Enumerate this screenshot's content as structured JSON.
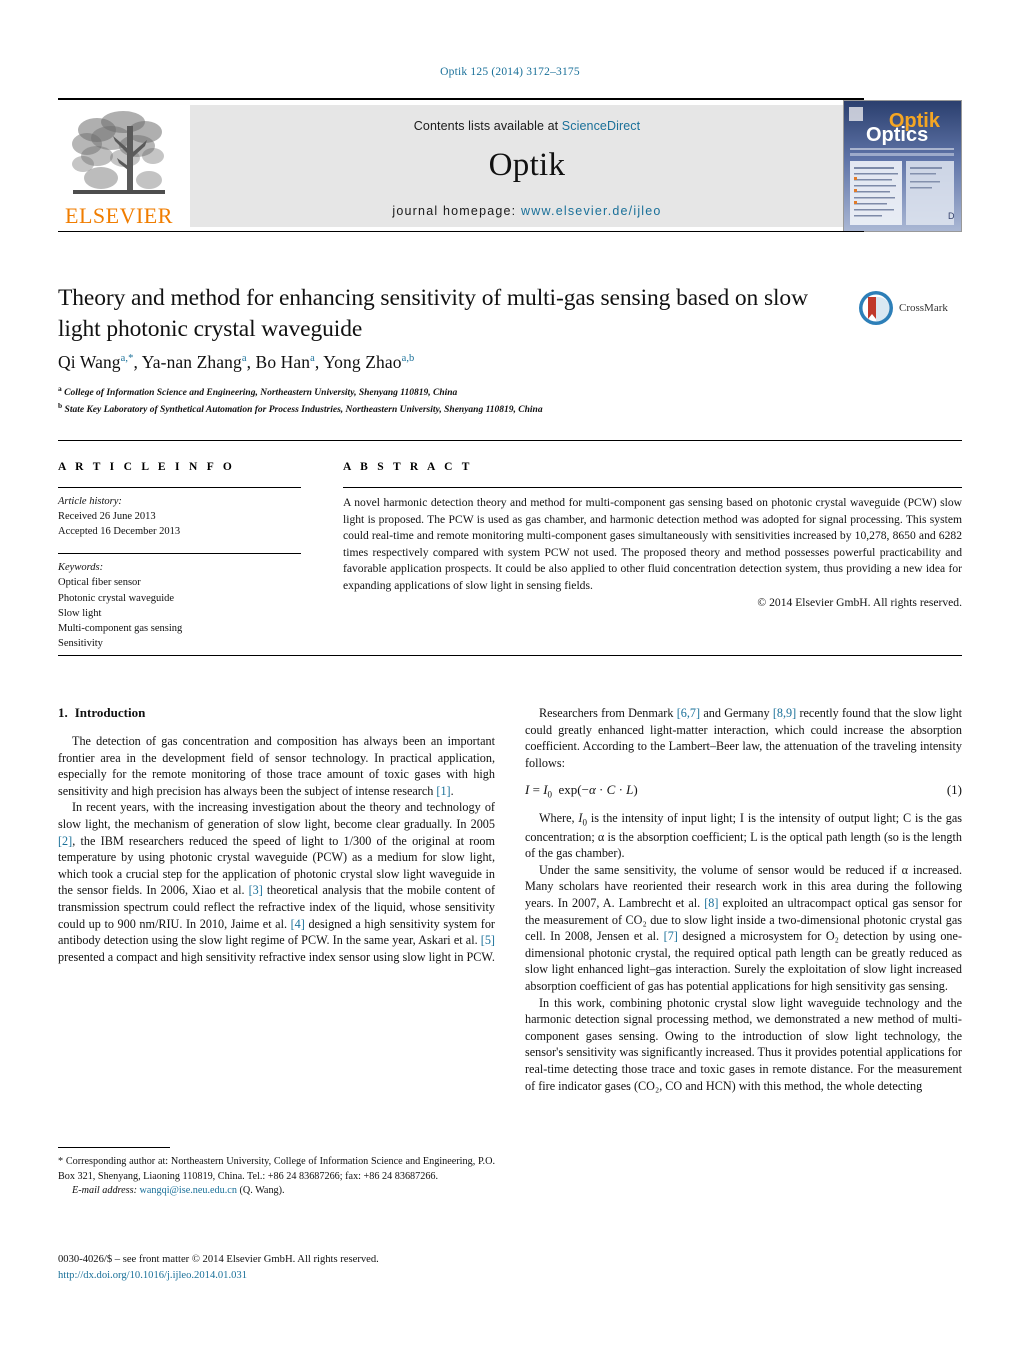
{
  "running_head": "Optik 125 (2014) 3172–3175",
  "masthead": {
    "publisher": "ELSEVIER",
    "contents_prefix": "Contents lists available at ",
    "contents_link": "ScienceDirect",
    "journal_name": "Optik",
    "homepage_prefix": "journal homepage:",
    "homepage_url": "www.elsevier.de/ijleo",
    "cover_title_top": "Optik",
    "cover_title_bottom": "Optics"
  },
  "title": "Theory and method for enhancing sensitivity of multi-gas sensing based on slow light photonic crystal waveguide",
  "crossmark_label": "CrossMark",
  "authors_html": "Qi Wang<sup>a,*</sup>, Ya-nan Zhang<sup>a</sup>, Bo Han<sup>a</sup>, Yong Zhao<sup>a,b</sup>",
  "affiliations": [
    "College of Information Science and Engineering, Northeastern University, Shenyang 110819, China",
    "State Key Laboratory of Synthetical Automation for Process Industries, Northeastern University, Shenyang 110819, China"
  ],
  "article_info": {
    "heading": "A R T I C L E   I N F O",
    "history_label": "Article history:",
    "history": [
      "Received 26 June 2013",
      "Accepted 16 December 2013"
    ],
    "keywords_label": "Keywords:",
    "keywords": [
      "Optical fiber sensor",
      "Photonic crystal waveguide",
      "Slow light",
      "Multi-component gas sensing",
      "Sensitivity"
    ]
  },
  "abstract": {
    "heading": "A B S T R A C T",
    "text": "A novel harmonic detection theory and method for multi-component gas sensing based on photonic crystal waveguide (PCW) slow light is proposed. The PCW is used as gas chamber, and harmonic detection method was adopted for signal processing. This system could real-time and remote monitoring multi-component gases simultaneously with sensitivities increased by 10,278, 8650 and 6282 times respectively compared with system PCW not used. The proposed theory and method possesses powerful practicability and favorable application prospects. It could be also applied to other fluid concentration detection system, thus providing a new idea for expanding applications of slow light in sensing fields.",
    "copyright": "© 2014 Elsevier GmbH. All rights reserved."
  },
  "sections": {
    "intro_number": "1.",
    "intro_title": "Introduction"
  },
  "left_column": {
    "p1_a": "The detection of gas concentration and composition has always been an important frontier area in the development field of sensor technology. In practical application, especially for the remote monitoring of those trace amount of toxic gases with high sensitivity and high precision has always been the subject of intense research ",
    "p1_ref": "[1]",
    "p1_b": ".",
    "p2_a": "In recent years, with the increasing investigation about the theory and technology of slow light, the mechanism of generation of slow light, become clear gradually. In 2005 ",
    "p2_ref1": "[2]",
    "p2_b": ", the IBM researchers reduced the speed of light to 1/300 of the original at room temperature by using photonic crystal waveguide (PCW) as a medium for slow light, which took a crucial step for the application of photonic crystal slow light waveguide in the sensor fields. In 2006, Xiao et al. ",
    "p2_ref2": "[3]",
    "p2_c": " theoretical analysis that the mobile content of transmission spectrum could reflect the refractive index of the liquid, whose sensitivity could up to 900 nm/RIU. In 2010, Jaime et al. ",
    "p2_ref3": "[4]",
    "p2_d": " designed a high sensitivity system for antibody detection using the slow light regime of PCW. In the same year, Askari et al. ",
    "p2_ref4": "[5]",
    "p2_e": " presented a compact and high sensitivity refractive index sensor using slow light in PCW."
  },
  "right_column": {
    "p1_a": "Researchers from Denmark ",
    "p1_ref1": "[6,7]",
    "p1_b": " and Germany ",
    "p1_ref2": "[8,9]",
    "p1_c": " recently found that the slow light could greatly enhanced light-matter interaction, which could increase the absorption coefficient. According to the Lambert–Beer law, the attenuation of the traveling intensity follows:",
    "equation_number": "(1)",
    "p2_a": "Where, I",
    "p2_b": " is the intensity of input light; I is the intensity of output light; C is the gas concentration; α is the absorption coefficient; L is the optical path length (so is the length of the gas chamber).",
    "p3_a": "Under the same sensitivity, the volume of sensor would be reduced if α increased. Many scholars have reoriented their research work in this area during the following years. In 2007, A. Lambrecht et al. ",
    "p3_ref1": "[8]",
    "p3_b": " exploited an ultracompact optical gas sensor for the measurement of CO₂ due to slow light inside a two-dimensional photonic crystal gas cell. In 2008, Jensen et al. ",
    "p3_ref2": "[7]",
    "p3_c": " designed a microsystem for O₂ detection by using one-dimensional photonic crystal, the required optical path length can be greatly reduced as slow light enhanced light–gas interaction. Surely the exploitation of slow light increased absorption coefficient of gas has potential applications for high sensitivity gas sensing.",
    "p4": "In this work, combining photonic crystal slow light waveguide technology and the harmonic detection signal processing method, we demonstrated a new method of multi-component gases sensing. Owing to the introduction of slow light technology, the sensor's sensitivity was significantly increased. Thus it provides potential applications for real-time detecting those trace and toxic gases in remote distance. For the measurement of fire indicator gases (CO₂, CO and HCN) with this method, the whole detecting"
  },
  "footnote": {
    "corresponding": "* Corresponding author at: Northeastern University, College of Information Science and Engineering, P.O. Box 321, Shenyang, Liaoning 110819, China. Tel.: +86 24 83687266; fax: +86 24 83687266.",
    "email_label": "E-mail address:",
    "email": "wangqi@ise.neu.edu.cn",
    "email_suffix": " (Q. Wang)."
  },
  "colophon": {
    "line1": "0030-4026/$ – see front matter © 2014 Elsevier GmbH. All rights reserved.",
    "doi": "http://dx.doi.org/10.1016/j.ijleo.2014.01.031"
  },
  "colors": {
    "link": "#1a7099",
    "elsevier_orange": "#f07d00",
    "banner_gray": "#e6e6e6"
  }
}
